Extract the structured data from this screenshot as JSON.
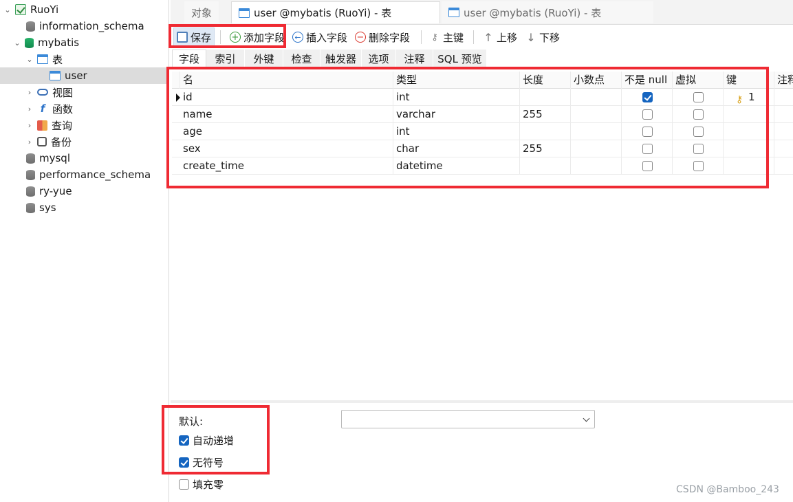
{
  "sidebar": {
    "items": [
      {
        "label": "RuoYi",
        "icon": "connection-icon"
      },
      {
        "label": "information_schema",
        "icon": "database-icon"
      },
      {
        "label": "mybatis",
        "icon": "database-icon"
      },
      {
        "label": "表",
        "icon": "table-group-icon"
      },
      {
        "label": "user",
        "icon": "table-icon"
      },
      {
        "label": "视图",
        "icon": "view-icon"
      },
      {
        "label": "函数",
        "icon": "function-icon"
      },
      {
        "label": "查询",
        "icon": "query-icon"
      },
      {
        "label": "备份",
        "icon": "backup-icon"
      },
      {
        "label": "mysql",
        "icon": "database-icon"
      },
      {
        "label": "performance_schema",
        "icon": "database-icon"
      },
      {
        "label": "ry-yue",
        "icon": "database-icon"
      },
      {
        "label": "sys",
        "icon": "database-icon"
      }
    ]
  },
  "tabs": [
    {
      "label": "对象"
    },
    {
      "label": "user @mybatis (RuoYi) - 表"
    },
    {
      "label": "user @mybatis (RuoYi) - 表"
    }
  ],
  "toolbar": {
    "save": "保存",
    "add_field": "添加字段",
    "insert_field": "插入字段",
    "delete_field": "删除字段",
    "primary_key": "主键",
    "move_up": "上移",
    "move_down": "下移"
  },
  "subtabs": [
    "字段",
    "索引",
    "外键",
    "检查",
    "触发器",
    "选项",
    "注释",
    "SQL 预览"
  ],
  "grid": {
    "columns": [
      "名",
      "类型",
      "长度",
      "小数点",
      "不是 null",
      "虚拟",
      "键",
      "注释"
    ],
    "rows": [
      {
        "name": "id",
        "type": "int",
        "length": "",
        "not_null": true,
        "virtual": false,
        "key": "1"
      },
      {
        "name": "name",
        "type": "varchar",
        "length": "255",
        "not_null": false,
        "virtual": false,
        "key": ""
      },
      {
        "name": "age",
        "type": "int",
        "length": "",
        "not_null": false,
        "virtual": false,
        "key": ""
      },
      {
        "name": "sex",
        "type": "char",
        "length": "255",
        "not_null": false,
        "virtual": false,
        "key": ""
      },
      {
        "name": "create_time",
        "type": "datetime",
        "length": "",
        "not_null": false,
        "virtual": false,
        "key": ""
      }
    ]
  },
  "properties": {
    "default_label": "默认:",
    "default_value": "",
    "auto_increment_label": "自动递增",
    "auto_increment": true,
    "unsigned_label": "无符号",
    "unsigned": true,
    "zerofill_label": "填充零",
    "zerofill": false
  },
  "watermark": "CSDN @Bamboo_243",
  "colors": {
    "highlight": "#ef2a33",
    "checkbox_checked": "#1565c0"
  }
}
